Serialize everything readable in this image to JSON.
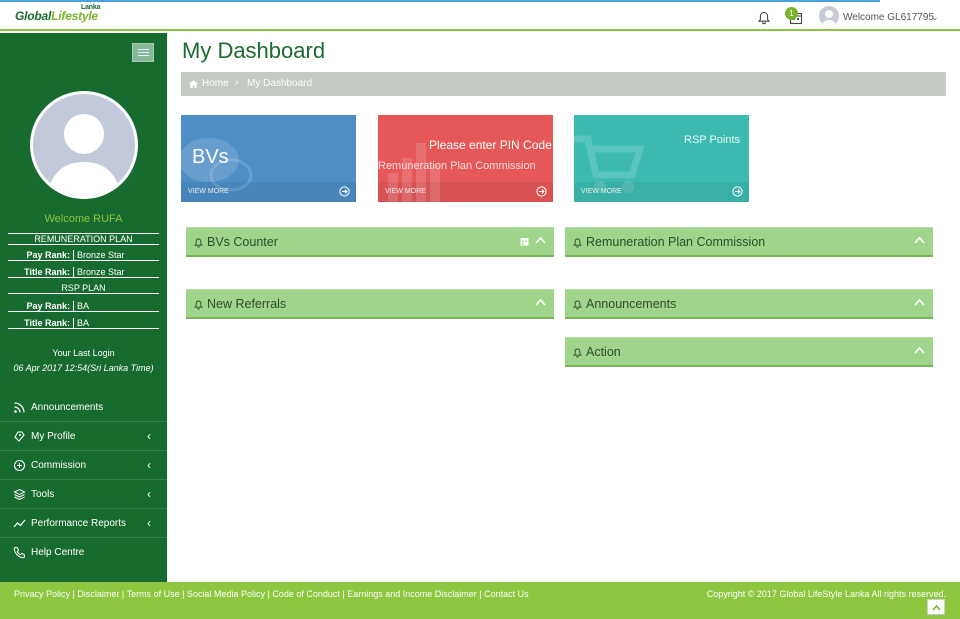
{
  "header": {
    "logo_main": "Global",
    "logo_life": "Lifestyle",
    "logo_sub": "Lanka",
    "notification_count": "1",
    "welcome_text": "Welcome GL617795"
  },
  "sidebar": {
    "welcome": "Welcome RUFA",
    "remuneration_plan_label": "REMUNERATION PLAN",
    "remuneration_pay_rank_label": "Pay Rank:",
    "remuneration_pay_rank_value": "Bronze Star",
    "remuneration_title_rank_label": "Title Rank:",
    "remuneration_title_rank_value": "Bronze Star",
    "rsp_plan_label": "RSP PLAN",
    "rsp_pay_rank_label": "Pay Rank:",
    "rsp_pay_rank_value": "BA",
    "rsp_title_rank_label": "Title Rank:",
    "rsp_title_rank_value": "BA",
    "last_login_label": "Your Last Login",
    "last_login_value": "06 Apr 2017 12:54(Sri Lanka Time)",
    "menu": [
      {
        "label": "Announcements",
        "icon": "rss-icon",
        "has_submenu": false
      },
      {
        "label": "My Profile",
        "icon": "profile-icon",
        "has_submenu": true
      },
      {
        "label": "Commission",
        "icon": "commission-icon",
        "has_submenu": true
      },
      {
        "label": "Tools",
        "icon": "layers-icon",
        "has_submenu": true
      },
      {
        "label": "Performance Reports",
        "icon": "chart-line-icon",
        "has_submenu": true
      },
      {
        "label": "Help Centre",
        "icon": "phone-icon",
        "has_submenu": false
      }
    ]
  },
  "main": {
    "title": "My Dashboard",
    "breadcrumb": {
      "home": "Home",
      "separator": "›",
      "current": "My Dashboard"
    },
    "tiles": {
      "bvs": {
        "label": "BVs",
        "footer": "VIEW MORE",
        "color": "#4d8ec6"
      },
      "rpc": {
        "line1": "Please enter PIN Code",
        "line2": "Remuneration Plan Commission",
        "footer": "VIEW MORE",
        "color": "#e65858"
      },
      "rsp": {
        "label": "RSP Points",
        "footer": "VIEW MORE",
        "color": "#3dbbb1"
      }
    },
    "panels": {
      "bvs_counter": "BVs Counter",
      "remuneration_commission": "Remuneration Plan Commission",
      "new_referrals": "New Referrals",
      "announcements": "Announcements",
      "action": "Action"
    }
  },
  "footer": {
    "links": [
      "Privacy Policy",
      "Disclaimer",
      "Terms of Use",
      "Social Media Policy",
      "Code of Conduct",
      "Earnings and Income Disclaimer",
      "Contact Us"
    ],
    "separator": " | ",
    "copyright": "Copyright © 2017 Global LifeStyle Lanka All rights reserved."
  },
  "colors": {
    "sidebar": "#176b2f",
    "accent_green": "#8dc63f",
    "panel_green": "#9ed58a",
    "breadcrumb_bg": "#c5c9c3"
  }
}
